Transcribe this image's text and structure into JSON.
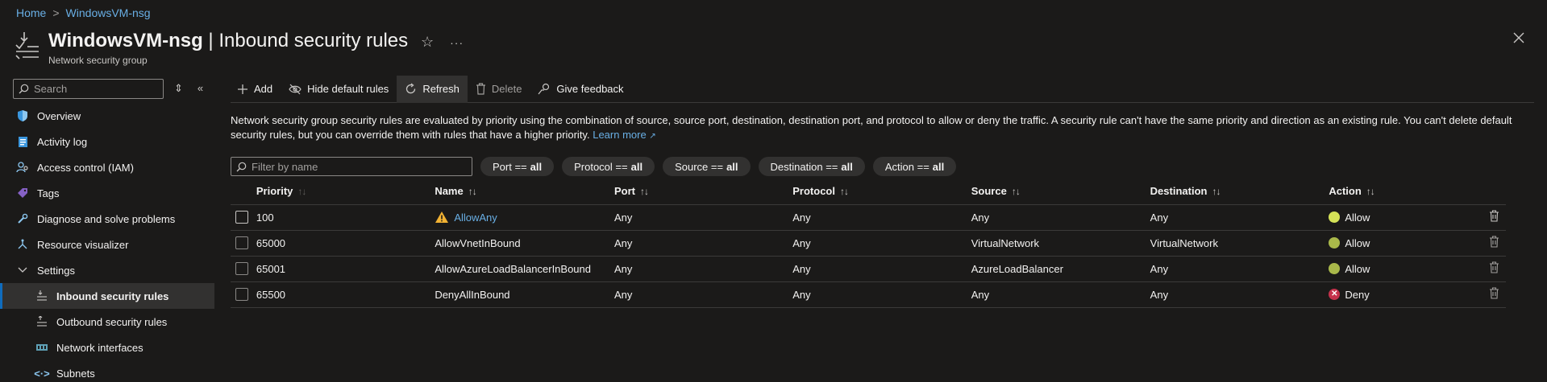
{
  "breadcrumb": {
    "home": "Home",
    "resource": "WindowsVM-nsg"
  },
  "header": {
    "title_main": "WindowsVM-nsg",
    "title_rest": " | Inbound security rules",
    "subtitle": "Network security group"
  },
  "sidebar": {
    "search_placeholder": "Search",
    "items": [
      {
        "label": "Overview",
        "icon": "shield-icon"
      },
      {
        "label": "Activity log",
        "icon": "activity-log-icon"
      },
      {
        "label": "Access control (IAM)",
        "icon": "iam-icon"
      },
      {
        "label": "Tags",
        "icon": "tag-icon"
      },
      {
        "label": "Diagnose and solve problems",
        "icon": "wrench-icon"
      },
      {
        "label": "Resource visualizer",
        "icon": "visualizer-icon"
      },
      {
        "label": "Settings",
        "icon": "chevron-down-icon"
      },
      {
        "label": "Inbound security rules",
        "icon": "inbound-rules-icon"
      },
      {
        "label": "Outbound security rules",
        "icon": "outbound-rules-icon"
      },
      {
        "label": "Network interfaces",
        "icon": "network-interface-icon"
      },
      {
        "label": "Subnets",
        "icon": "subnet-icon"
      }
    ]
  },
  "toolbar": {
    "add": "Add",
    "hide_default": "Hide default rules",
    "refresh": "Refresh",
    "delete": "Delete",
    "feedback": "Give feedback"
  },
  "description": {
    "text": "Network security group security rules are evaluated by priority using the combination of source, source port, destination, destination port, and protocol to allow or deny the traffic. A security rule can't have the same priority and direction as an existing rule. You can't delete default security rules, but you can override them with rules that have a higher priority.",
    "learn_more": "Learn more"
  },
  "filters": {
    "placeholder": "Filter by name",
    "pills": [
      {
        "label": "Port ==",
        "value": "all"
      },
      {
        "label": "Protocol ==",
        "value": "all"
      },
      {
        "label": "Source ==",
        "value": "all"
      },
      {
        "label": "Destination ==",
        "value": "all"
      },
      {
        "label": "Action ==",
        "value": "all"
      }
    ]
  },
  "table": {
    "headers": [
      "Priority",
      "Name",
      "Port",
      "Protocol",
      "Source",
      "Destination",
      "Action"
    ],
    "rows": [
      {
        "priority": "100",
        "name": "AllowAny",
        "port": "Any",
        "protocol": "Any",
        "source": "Any",
        "destination": "Any",
        "action": "Allow"
      },
      {
        "priority": "65000",
        "name": "AllowVnetInBound",
        "port": "Any",
        "protocol": "Any",
        "source": "VirtualNetwork",
        "destination": "VirtualNetwork",
        "action": "Allow"
      },
      {
        "priority": "65001",
        "name": "AllowAzureLoadBalancerInBound",
        "port": "Any",
        "protocol": "Any",
        "source": "AzureLoadBalancer",
        "destination": "Any",
        "action": "Allow"
      },
      {
        "priority": "65500",
        "name": "DenyAllInBound",
        "port": "Any",
        "protocol": "Any",
        "source": "Any",
        "destination": "Any",
        "action": "Deny"
      }
    ]
  },
  "colors": {
    "accent": "#69afe5",
    "allow": "#d4e157",
    "deny": "#c4314b",
    "warning": "#f2b233"
  }
}
